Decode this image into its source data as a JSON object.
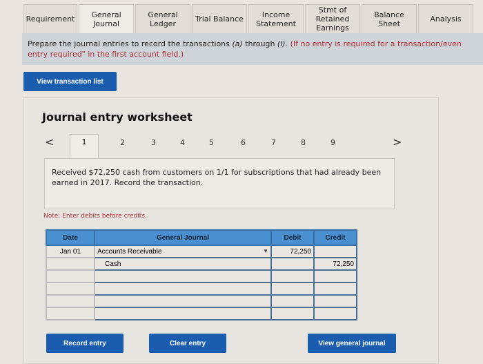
{
  "tabs": [
    {
      "label": "Requirement",
      "active": false
    },
    {
      "label": "General Journal",
      "active": true
    },
    {
      "label": "General Ledger",
      "active": false
    },
    {
      "label": "Trial Balance",
      "active": false
    },
    {
      "label": "Income Statement",
      "active": false
    },
    {
      "label": "Stmt of Retained Earnings",
      "active": false
    },
    {
      "label": "Balance Sheet",
      "active": false
    },
    {
      "label": "Analysis",
      "active": false
    }
  ],
  "instructions": {
    "main": "Prepare the journal entries to record the transactions (a) through (l).",
    "note": "(If no entry is required for a transaction/event, select \"No journal entry required\" in the first account field.)",
    "visible_line1": "Prepare the journal entries to record the transactions ",
    "a": "(a)",
    "through": " through ",
    "l": "(l)",
    "period": ". ",
    "red1": "(If no entry is required for a transaction/even",
    "red2": "entry required\" in the first account field.)"
  },
  "buttons": {
    "view_transactions": "View transaction list",
    "record": "Record entry",
    "clear": "Clear entry",
    "view_journal": "View general journal"
  },
  "worksheet": {
    "title": "Journal entry worksheet",
    "pages": [
      "1",
      "2",
      "3",
      "4",
      "5",
      "6",
      "7",
      "8",
      "9"
    ],
    "current_page": "1",
    "prev_icon": "<",
    "next_icon": ">",
    "description": "Received $72,250 cash from customers on 1/1 for subscriptions that had already been earned in 2017. Record the transaction.",
    "note": "Note: Enter debits before credits."
  },
  "journal": {
    "headers": [
      "Date",
      "General Journal",
      "Debit",
      "Credit"
    ],
    "rows": [
      {
        "date": "Jan 01",
        "account": "Accounts Receivable",
        "debit": "72,250",
        "credit": ""
      },
      {
        "date": "",
        "account": "Cash",
        "debit": "",
        "credit": "72,250"
      },
      {
        "date": "",
        "account": "",
        "debit": "",
        "credit": ""
      },
      {
        "date": "",
        "account": "",
        "debit": "",
        "credit": ""
      },
      {
        "date": "",
        "account": "",
        "debit": "",
        "credit": ""
      },
      {
        "date": "",
        "account": "",
        "debit": "",
        "credit": ""
      }
    ]
  }
}
